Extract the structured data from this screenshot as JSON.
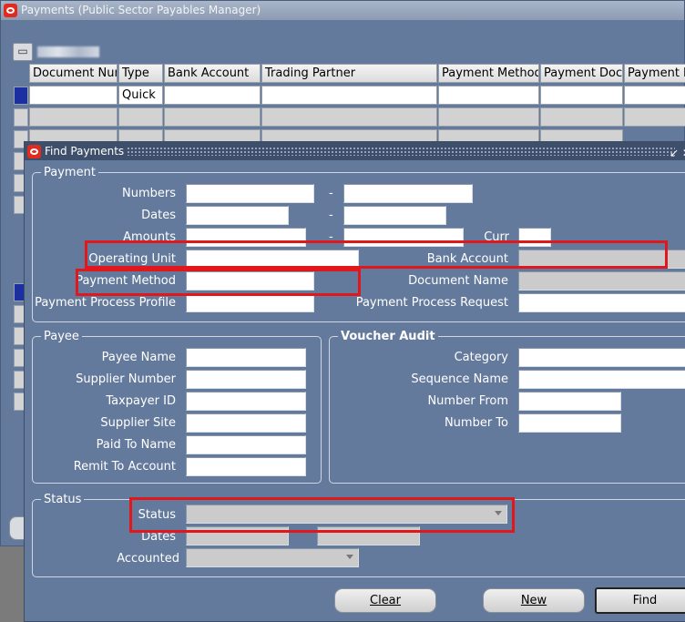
{
  "back_window": {
    "title": "Payments (Public Sector Payables Manager)",
    "tool_icon": "folder-icon",
    "columns": [
      "Document Num",
      "Type",
      "Bank Account",
      "Trading Partner",
      "Payment Method",
      "Payment Docu",
      "Payment P"
    ],
    "first_row_type": "Quick"
  },
  "dialog": {
    "title": "Find Payments",
    "controls": "↙ ✕",
    "payment_group": {
      "title": "Payment",
      "numbers_label": "Numbers",
      "dates_label": "Dates",
      "amounts_label": "Amounts",
      "curr_label": "Curr",
      "operating_unit_label": "Operating Unit",
      "bank_account_label": "Bank Account",
      "payment_method_label": "Payment Method",
      "document_name_label": "Document Name",
      "payment_process_profile_label": "Payment Process Profile",
      "payment_process_request_label": "Payment Process Request",
      "range_separator": "-"
    },
    "payee_group": {
      "title": "Payee",
      "payee_name_label": "Payee Name",
      "supplier_number_label": "Supplier Number",
      "taxpayer_id_label": "Taxpayer ID",
      "supplier_site_label": "Supplier Site",
      "paid_to_name_label": "Paid To Name",
      "remit_to_account_label": "Remit To Account"
    },
    "voucher_group": {
      "title": "Voucher Audit",
      "category_label": "Category",
      "sequence_name_label": "Sequence Name",
      "number_from_label": "Number From",
      "number_to_label": "Number To"
    },
    "status_group": {
      "title": "Status",
      "status_label": "Status",
      "dates_label": "Dates",
      "accounted_label": "Accounted"
    },
    "buttons": {
      "clear": "Clear",
      "new": "New",
      "find": "Find"
    }
  },
  "highlights_color": "#e0181b"
}
